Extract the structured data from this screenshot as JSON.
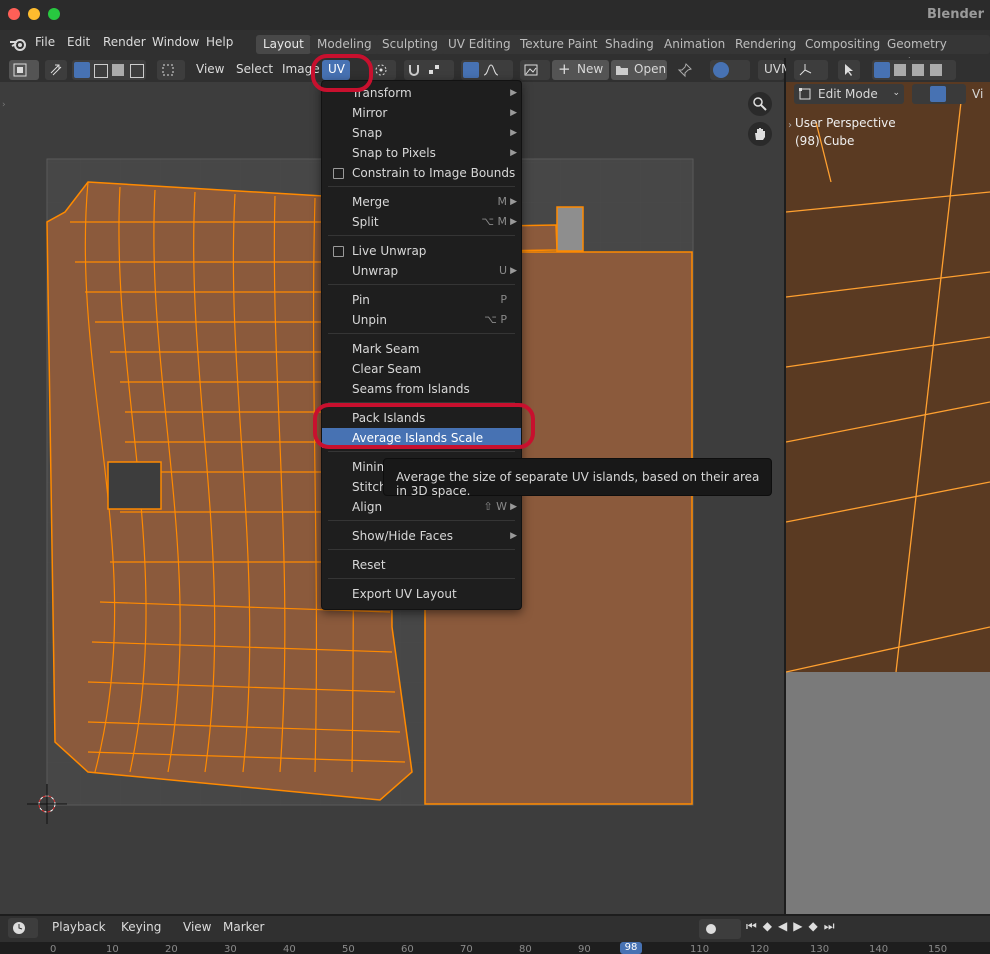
{
  "app": {
    "title": "Blender"
  },
  "menubar": {
    "items": [
      "File",
      "Edit",
      "Render",
      "Window",
      "Help"
    ],
    "workspaces": [
      "Layout",
      "Modeling",
      "Sculpting",
      "UV Editing",
      "Texture Paint",
      "Shading",
      "Animation",
      "Rendering",
      "Compositing",
      "Geometry Nodes"
    ],
    "active_workspace": "Layout"
  },
  "uv_header": {
    "menus": [
      "View",
      "Select",
      "Image",
      "UV"
    ],
    "new_label": "New",
    "open_label": "Open",
    "uvmap_label": "UVM"
  },
  "viewport": {
    "mode": "Edit Mode",
    "view_label": "Vi",
    "perspective": "User Perspective",
    "object": "(98) Cube"
  },
  "uv_menu": {
    "items": [
      {
        "label": "Transform",
        "submenu": true
      },
      {
        "label": "Mirror",
        "submenu": true
      },
      {
        "label": "Snap",
        "submenu": true
      },
      {
        "label": "Snap to Pixels",
        "submenu": true
      },
      {
        "label": "Constrain to Image Bounds",
        "checkbox": true
      },
      {
        "label": "Merge",
        "shortcut": "M",
        "submenu": true
      },
      {
        "label": "Split",
        "shortcut": "⌥ M",
        "submenu": true
      },
      {
        "label": "Live Unwrap",
        "checkbox": true
      },
      {
        "label": "Unwrap",
        "shortcut": "U",
        "submenu": true
      },
      {
        "label": "Pin",
        "shortcut": "P"
      },
      {
        "label": "Unpin",
        "shortcut": "⌥ P"
      },
      {
        "label": "Mark Seam"
      },
      {
        "label": "Clear Seam"
      },
      {
        "label": "Seams from Islands"
      },
      {
        "label": "Pack Islands"
      },
      {
        "label": "Average Islands Scale",
        "highlighted": true
      },
      {
        "label": "Minimize Stretch"
      },
      {
        "label": "Stitch"
      },
      {
        "label": "Align",
        "shortcut": "⇧ W",
        "submenu": true
      },
      {
        "label": "Show/Hide Faces",
        "submenu": true
      },
      {
        "label": "Reset"
      },
      {
        "label": "Export UV Layout"
      }
    ],
    "tooltip": "Average the size of separate UV islands, based on their area in 3D space."
  },
  "timeline": {
    "menus": [
      "Playback",
      "Keying",
      "View",
      "Marker"
    ],
    "ruler": [
      "0",
      "10",
      "20",
      "30",
      "40",
      "50",
      "60",
      "70",
      "80",
      "90",
      "98",
      "110",
      "120",
      "130",
      "140",
      "150"
    ],
    "current_frame": "98"
  },
  "colors": {
    "uv_face": "#8b5a3c",
    "uv_edge": "#ff8a00",
    "highlight": "#4772b3",
    "annotation": "#c8102e"
  }
}
